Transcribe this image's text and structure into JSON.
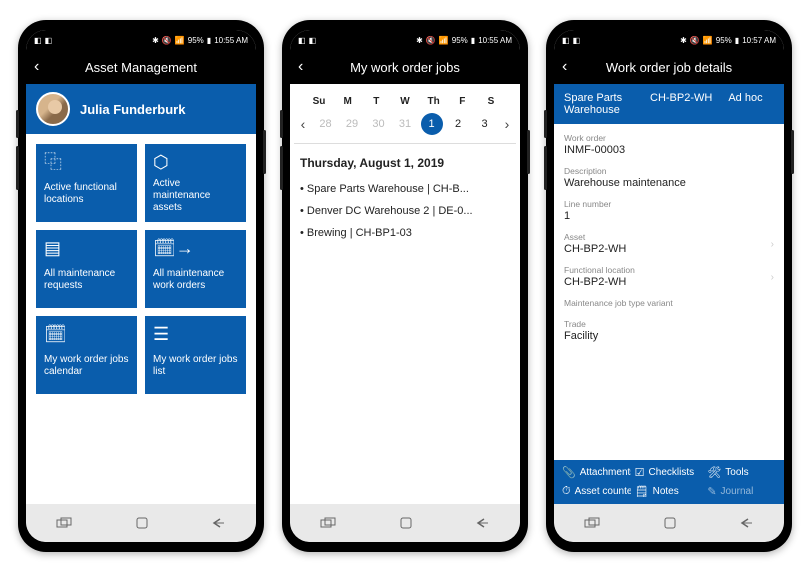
{
  "statusbar": {
    "signal": "95%",
    "time1": "10:55 AM",
    "time3": "10:57 AM"
  },
  "phone1": {
    "header": "Asset Management",
    "user": "Julia Funderburk",
    "tiles": [
      {
        "label": "Active functional locations"
      },
      {
        "label": "Active maintenance assets"
      },
      {
        "label": "All maintenance requests"
      },
      {
        "label": "All maintenance work orders"
      },
      {
        "label": "My work order jobs calendar"
      },
      {
        "label": "My work order jobs list"
      }
    ]
  },
  "phone2": {
    "header": "My work order jobs",
    "dayheads": [
      "Su",
      "M",
      "T",
      "W",
      "Th",
      "F",
      "S"
    ],
    "days": [
      "28",
      "29",
      "30",
      "31",
      "1",
      "2",
      "3"
    ],
    "selected_date": "Thursday, August 1, 2019",
    "jobs": [
      "• Spare Parts Warehouse | CH-B...",
      "• Denver DC Warehouse 2 | DE-0...",
      "• Brewing | CH-BP1-03"
    ]
  },
  "phone3": {
    "header": "Work order job details",
    "top": {
      "a": "Spare Parts Warehouse",
      "b": "CH-BP2-WH",
      "c": "Ad hoc"
    },
    "fields": [
      {
        "label": "Work order",
        "value": "INMF-00003"
      },
      {
        "label": "Description",
        "value": "Warehouse maintenance"
      },
      {
        "label": "Line number",
        "value": "1"
      },
      {
        "label": "Asset",
        "value": "CH-BP2-WH",
        "nav": true
      },
      {
        "label": "Functional location",
        "value": "CH-BP2-WH",
        "nav": true
      },
      {
        "label": "Maintenance job type variant",
        "value": ""
      },
      {
        "label": "Trade",
        "value": "Facility"
      }
    ],
    "actions": {
      "attachments": "Attachments",
      "checklists": "Checklists",
      "tools": "Tools",
      "counters": "Asset counters",
      "notes": "Notes",
      "journals": "Journal"
    }
  }
}
